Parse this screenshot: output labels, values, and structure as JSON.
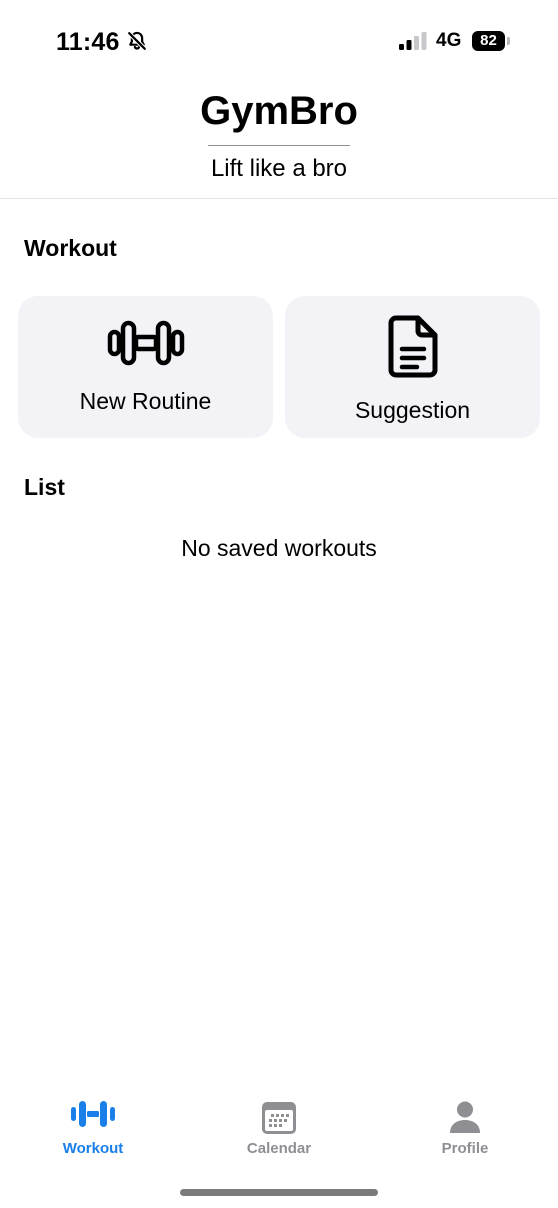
{
  "status_bar": {
    "time": "11:46",
    "network": "4G",
    "battery": "82",
    "icons": [
      "bell-slash-icon",
      "signal-icon",
      "battery-icon"
    ]
  },
  "header": {
    "title": "GymBro",
    "subtitle": "Lift like a bro"
  },
  "workout_section": {
    "heading": "Workout",
    "cards": [
      {
        "label": "New Routine",
        "icon": "dumbbell-icon"
      },
      {
        "label": "Suggestion",
        "icon": "document-icon"
      }
    ]
  },
  "list_section": {
    "heading": "List",
    "empty_text": "No saved workouts"
  },
  "tab_bar": {
    "items": [
      {
        "label": "Workout",
        "icon": "dumbbell-icon",
        "active": true
      },
      {
        "label": "Calendar",
        "icon": "calendar-icon",
        "active": false
      },
      {
        "label": "Profile",
        "icon": "person-icon",
        "active": false
      }
    ]
  },
  "colors": {
    "accent": "#1a7fe8",
    "inactive_tab": "#8e8e93",
    "card_background": "#f2f2f7"
  }
}
